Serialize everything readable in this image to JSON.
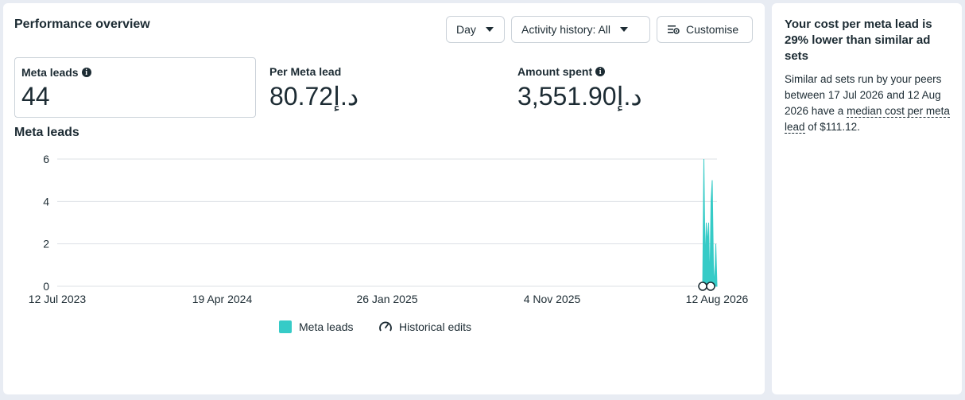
{
  "overview": {
    "title": "Performance overview",
    "day_label": "Day",
    "activity_label": "Activity history: All",
    "customise_label": "Customise"
  },
  "metrics": {
    "leads": {
      "label": "Meta leads",
      "value": "44"
    },
    "per_lead": {
      "label": "Per Meta lead",
      "value": "80.72د.إ"
    },
    "spent": {
      "label": "Amount spent",
      "value": "3,551.90د.إ"
    }
  },
  "chart_title": "Meta leads",
  "chart_data": {
    "type": "area",
    "title": "Meta leads",
    "y_ticks": [
      "0",
      "2",
      "4",
      "6"
    ],
    "x_ticks": [
      "12 Jul 2023",
      "19 Apr 2024",
      "26 Jan 2025",
      "4 Nov 2025",
      "12 Aug 2026"
    ],
    "ylim": [
      0,
      6
    ],
    "series": [
      {
        "name": "Meta leads",
        "color": "#36cbc7",
        "values": [
          0,
          6,
          1,
          3,
          2,
          3,
          0,
          4,
          5,
          1,
          0,
          2,
          0
        ]
      }
    ],
    "legend": [
      "Meta leads",
      "Historical edits"
    ]
  },
  "sidebar": {
    "heading": "Your cost per meta lead is 29% lower than similar ad sets",
    "body_part1": "Similar ad sets run by your peers between 17 Jul 2026 and 12 Aug 2026 have a ",
    "body_link": "median cost per meta lead",
    "body_part2": " of $111.12."
  }
}
